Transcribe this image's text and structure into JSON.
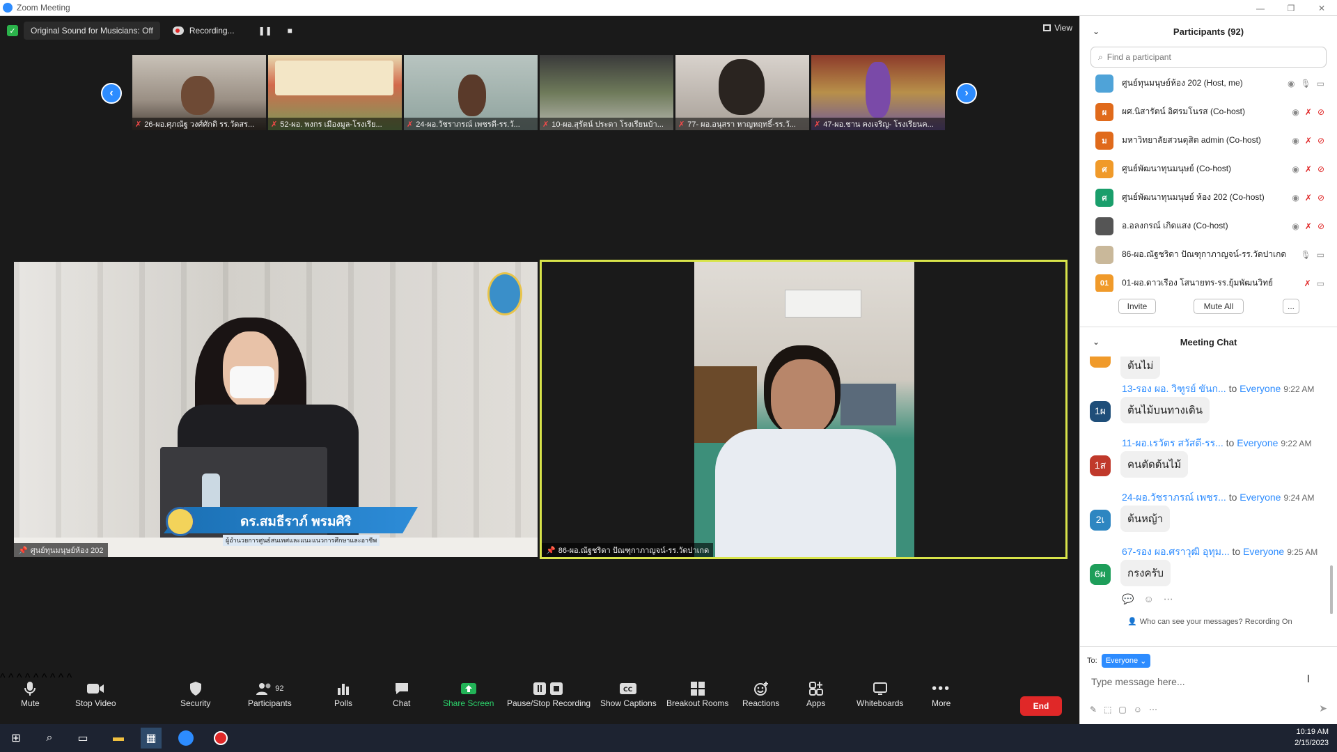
{
  "window": {
    "title": "Zoom Meeting"
  },
  "topbar": {
    "original_sound": "Original Sound for Musicians: Off",
    "recording": "Recording...",
    "view": "View"
  },
  "thumbnails": [
    {
      "name": "26-ผอ.ศุภณัฐ วงศ์ศักดิ รร.วัดสร...",
      "bg": "#8a7d6f"
    },
    {
      "name": "52-ผอ. พงกร เมืองมูล-โรงเรีย...",
      "bg": "#b88a6a"
    },
    {
      "name": "24-ผอ.วัชราภรณ์ เพชรดี-รร.วั...",
      "bg": "#9a9470"
    },
    {
      "name": "10-ผอ.สุรัตน์ ประดา โรงเรียนบ้า...",
      "bg": "#6f7a5c"
    },
    {
      "name": "77- ผอ.อนุสรา หาญหฤทธิ์-รร.วั...",
      "bg": "#7c7068"
    },
    {
      "name": "47-ผอ.ชาน คงเจริญ- โรงเรียนค...",
      "bg": "#8c6f5a"
    }
  ],
  "main_video_left": {
    "label": "ศูนย์ทุนมนุษย์ห้อง 202",
    "lower_third_name": "ดร.สมธีราภ์ พรมศิริ",
    "lower_third_role": "ผู้อำนวยการศูนย์สนเทศและแนะแนวการศึกษาและอาชีพ"
  },
  "main_video_right": {
    "label": "86-ผอ.ณัฐชริดา ปัณฑุกาภาญจน์-รร.วัดปาเกด"
  },
  "toolbar": {
    "mute": "Mute",
    "stop_video": "Stop Video",
    "security": "Security",
    "participants": "Participants",
    "participants_count": "92",
    "polls": "Polls",
    "chat": "Chat",
    "share_screen": "Share Screen",
    "pause_stop_recording": "Pause/Stop Recording",
    "show_captions": "Show Captions",
    "breakout_rooms": "Breakout Rooms",
    "reactions": "Reactions",
    "apps": "Apps",
    "whiteboards": "Whiteboards",
    "more": "More",
    "end": "End"
  },
  "participants_panel": {
    "title": "Participants (92)",
    "search_placeholder": "Find a participant",
    "list": [
      {
        "name": "ศูนย์ทุนมนุษย์ห้อง 202 (Host, me)",
        "avatar": "",
        "color": "#4fa3d8",
        "mic_muted": false,
        "video_off": false
      },
      {
        "name": "ผศ.นิสารัตน์ อิศรมโนรส (Co-host)",
        "avatar": "ผ",
        "color": "#e06a1b",
        "mic_muted": true,
        "video_off": true
      },
      {
        "name": "มหาวิทยาลัยสวนดุสิต admin (Co-host)",
        "avatar": "ม",
        "color": "#e06a1b",
        "mic_muted": true,
        "video_off": true
      },
      {
        "name": "ศูนย์พัฒนาทุนมนุษย์ (Co-host)",
        "avatar": "ศ",
        "color": "#f09a2a",
        "mic_muted": true,
        "video_off": true
      },
      {
        "name": "ศูนย์พัฒนาทุนมนุษย์ ห้อง 202 (Co-host)",
        "avatar": "ศ",
        "color": "#1a9e6b",
        "mic_muted": true,
        "video_off": true
      },
      {
        "name": "อ.อลงกรณ์ เกิดแสง (Co-host)",
        "avatar": "",
        "color": "#555555",
        "mic_muted": true,
        "video_off": true
      },
      {
        "name": "86-ผอ.ณัฐชริดา ปัณฑุกาภาญจน์-รร.วัดปาเกด",
        "avatar": "",
        "color": "#c9b89a",
        "mic_muted": false,
        "video_off": false
      },
      {
        "name": "01-ผอ.ดาวเรือง โสนายทร-รร.ยุ้มพัฒนวิทย์",
        "avatar": "01",
        "color": "#f09a2a",
        "mic_muted": true,
        "video_off": false
      }
    ],
    "invite": "Invite",
    "mute_all": "Mute All",
    "more": "..."
  },
  "chat_panel": {
    "title": "Meeting Chat",
    "partial_text": "ต้นไม่",
    "messages": [
      {
        "avatar": "1ผ",
        "color": "#1f4e79",
        "from": "13-รอง ผอ. วิฑูรย์ ขันก...",
        "to": "to",
        "everyone": "Everyone",
        "time": "9:22 AM",
        "text": "ต้นไม้บนทางเดิน"
      },
      {
        "avatar": "1ส",
        "color": "#c0392b",
        "from": "11-ผอ.เรวัตร สวัสดี-รร...",
        "to": "to",
        "everyone": "Everyone",
        "time": "9:22 AM",
        "text": "คนตัดต้นไม้"
      },
      {
        "avatar": "2เ",
        "color": "#2e86c1",
        "from": "24-ผอ.วัชราภรณ์ เพชร...",
        "to": "to",
        "everyone": "Everyone",
        "time": "9:24 AM",
        "text": "ต้นหญ้า"
      },
      {
        "avatar": "6ผ",
        "color": "#1e9e5a",
        "from": "67-รอง ผอ.ศราวุฒิ อุทุม...",
        "to": "to",
        "everyone": "Everyone",
        "time": "9:25 AM",
        "text": "กรงครับ"
      }
    ],
    "visibility_note": "Who can see your messages? Recording On",
    "to_label": "To:",
    "to_value": "Everyone",
    "type_placeholder": "Type message here..."
  },
  "taskbar": {
    "time": "10:19 AM",
    "date": "2/15/2023"
  }
}
